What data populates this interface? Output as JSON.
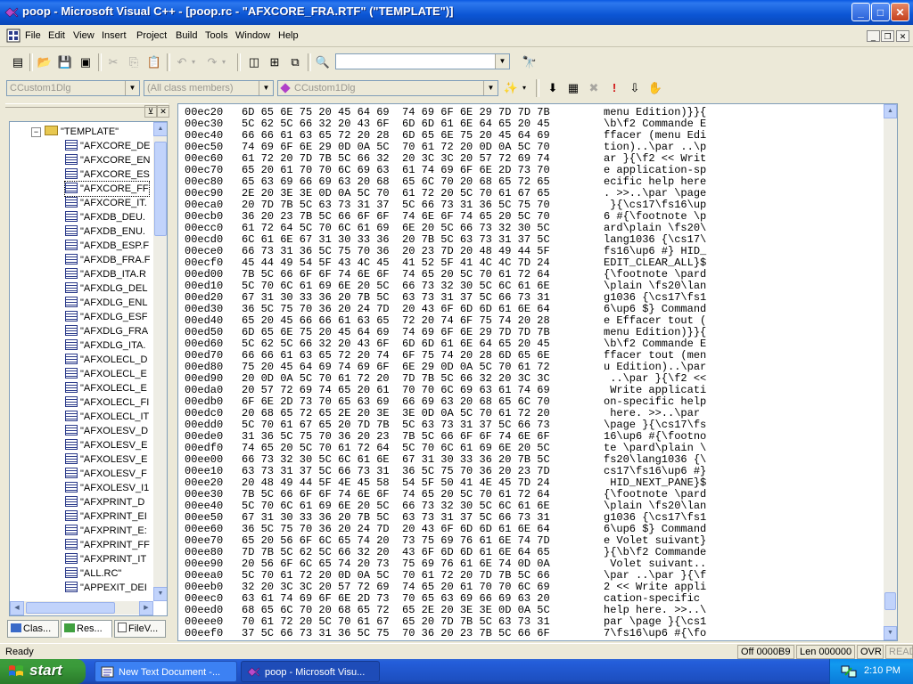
{
  "window": {
    "title": "poop - Microsoft Visual C++ - [poop.rc - \"AFXCORE_FRA.RTF\" (\"TEMPLATE\")]",
    "buttons": {
      "minimize": "_",
      "maximize": "□",
      "close": "✕"
    }
  },
  "menu": [
    "File",
    "Edit",
    "View",
    "Insert",
    "Project",
    "Build",
    "Tools",
    "Window",
    "Help"
  ],
  "wizardbar": {
    "class_combo": "CCustom1Dlg",
    "filter_combo": "(All class members)",
    "member_combo": "CCustom1Dlg"
  },
  "find_combo": "",
  "tree": {
    "root": "\"TEMPLATE\"",
    "items": [
      "\"AFXCORE_DE",
      "\"AFXCORE_EN",
      "\"AFXCORE_ES",
      "\"AFXCORE_FF",
      "\"AFXCORE_IT.",
      "\"AFXDB_DEU.",
      "\"AFXDB_ENU.",
      "\"AFXDB_ESP.F",
      "\"AFXDB_FRA.F",
      "\"AFXDB_ITA.R",
      "\"AFXDLG_DEL",
      "\"AFXDLG_ENL",
      "\"AFXDLG_ESF",
      "\"AFXDLG_FRA",
      "\"AFXDLG_ITA.",
      "\"AFXOLECL_D",
      "\"AFXOLECL_E",
      "\"AFXOLECL_E",
      "\"AFXOLECL_FI",
      "\"AFXOLECL_IT",
      "\"AFXOLESV_D",
      "\"AFXOLESV_E",
      "\"AFXOLESV_E",
      "\"AFXOLESV_F",
      "\"AFXOLESV_I1",
      "\"AFXPRINT_D",
      "\"AFXPRINT_EI",
      "\"AFXPRINT_E:",
      "\"AFXPRINT_FF",
      "\"AFXPRINT_IT",
      "\"ALL.RC\"",
      "\"APPEXIT_DEI"
    ]
  },
  "tabs": [
    "Clas...",
    "Res...",
    "FileV..."
  ],
  "hex_rows": [
    {
      "addr": "00ec20",
      "bytes": "6D 65 6E 75 20 45 64 69  74 69 6F 6E 29 7D 7D 7B",
      "ascii": "menu Edition)}}{"
    },
    {
      "addr": "00ec30",
      "bytes": "5C 62 5C 66 32 20 43 6F  6D 6D 61 6E 64 65 20 45",
      "ascii": "\\b\\f2 Commande E"
    },
    {
      "addr": "00ec40",
      "bytes": "66 66 61 63 65 72 20 28  6D 65 6E 75 20 45 64 69",
      "ascii": "ffacer (menu Edi"
    },
    {
      "addr": "00ec50",
      "bytes": "74 69 6F 6E 29 0D 0A 5C  70 61 72 20 0D 0A 5C 70",
      "ascii": "tion)..\\par ..\\p"
    },
    {
      "addr": "00ec60",
      "bytes": "61 72 20 7D 7B 5C 66 32  20 3C 3C 20 57 72 69 74",
      "ascii": "ar }{\\f2 << Writ"
    },
    {
      "addr": "00ec70",
      "bytes": "65 20 61 70 70 6C 69 63  61 74 69 6F 6E 2D 73 70",
      "ascii": "e application-sp"
    },
    {
      "addr": "00ec80",
      "bytes": "65 63 69 66 69 63 20 68  65 6C 70 20 68 65 72 65",
      "ascii": "ecific help here"
    },
    {
      "addr": "00ec90",
      "bytes": "2E 20 3E 3E 0D 0A 5C 70  61 72 20 5C 70 61 67 65",
      "ascii": ". >>..\\par \\page"
    },
    {
      "addr": "00eca0",
      "bytes": "20 7D 7B 5C 63 73 31 37  5C 66 73 31 36 5C 75 70",
      "ascii": " }{\\cs17\\fs16\\up"
    },
    {
      "addr": "00ecb0",
      "bytes": "36 20 23 7B 5C 66 6F 6F  74 6E 6F 74 65 20 5C 70",
      "ascii": "6 #{\\footnote \\p"
    },
    {
      "addr": "00ecc0",
      "bytes": "61 72 64 5C 70 6C 61 69  6E 20 5C 66 73 32 30 5C",
      "ascii": "ard\\plain \\fs20\\"
    },
    {
      "addr": "00ecd0",
      "bytes": "6C 61 6E 67 31 30 33 36  20 7B 5C 63 73 31 37 5C",
      "ascii": "lang1036 {\\cs17\\"
    },
    {
      "addr": "00ece0",
      "bytes": "66 73 31 36 5C 75 70 36  20 23 7D 20 48 49 44 5F",
      "ascii": "fs16\\up6 #} HID_"
    },
    {
      "addr": "00ecf0",
      "bytes": "45 44 49 54 5F 43 4C 45  41 52 5F 41 4C 4C 7D 24",
      "ascii": "EDIT_CLEAR_ALL}$"
    },
    {
      "addr": "00ed00",
      "bytes": "7B 5C 66 6F 6F 74 6E 6F  74 65 20 5C 70 61 72 64",
      "ascii": "{\\footnote \\pard"
    },
    {
      "addr": "00ed10",
      "bytes": "5C 70 6C 61 69 6E 20 5C  66 73 32 30 5C 6C 61 6E",
      "ascii": "\\plain \\fs20\\lan"
    },
    {
      "addr": "00ed20",
      "bytes": "67 31 30 33 36 20 7B 5C  63 73 31 37 5C 66 73 31",
      "ascii": "g1036 {\\cs17\\fs1"
    },
    {
      "addr": "00ed30",
      "bytes": "36 5C 75 70 36 20 24 7D  20 43 6F 6D 6D 61 6E 64",
      "ascii": "6\\up6 $} Command"
    },
    {
      "addr": "00ed40",
      "bytes": "65 20 45 66 66 61 63 65  72 20 74 6F 75 74 20 28",
      "ascii": "e Effacer tout ("
    },
    {
      "addr": "00ed50",
      "bytes": "6D 65 6E 75 20 45 64 69  74 69 6F 6E 29 7D 7D 7B",
      "ascii": "menu Edition)}}{"
    },
    {
      "addr": "00ed60",
      "bytes": "5C 62 5C 66 32 20 43 6F  6D 6D 61 6E 64 65 20 45",
      "ascii": "\\b\\f2 Commande E"
    },
    {
      "addr": "00ed70",
      "bytes": "66 66 61 63 65 72 20 74  6F 75 74 20 28 6D 65 6E",
      "ascii": "ffacer tout (men"
    },
    {
      "addr": "00ed80",
      "bytes": "75 20 45 64 69 74 69 6F  6E 29 0D 0A 5C 70 61 72",
      "ascii": "u Edition)..\\par"
    },
    {
      "addr": "00ed90",
      "bytes": "20 0D 0A 5C 70 61 72 20  7D 7B 5C 66 32 20 3C 3C",
      "ascii": " ..\\par }{\\f2 <<"
    },
    {
      "addr": "00eda0",
      "bytes": "20 57 72 69 74 65 20 61  70 70 6C 69 63 61 74 69",
      "ascii": " Write applicati"
    },
    {
      "addr": "00edb0",
      "bytes": "6F 6E 2D 73 70 65 63 69  66 69 63 20 68 65 6C 70",
      "ascii": "on-specific help"
    },
    {
      "addr": "00edc0",
      "bytes": "20 68 65 72 65 2E 20 3E  3E 0D 0A 5C 70 61 72 20",
      "ascii": " here. >>..\\par "
    },
    {
      "addr": "00edd0",
      "bytes": "5C 70 61 67 65 20 7D 7B  5C 63 73 31 37 5C 66 73",
      "ascii": "\\page }{\\cs17\\fs"
    },
    {
      "addr": "00ede0",
      "bytes": "31 36 5C 75 70 36 20 23  7B 5C 66 6F 6F 74 6E 6F",
      "ascii": "16\\up6 #{\\footno"
    },
    {
      "addr": "00edf0",
      "bytes": "74 65 20 5C 70 61 72 64  5C 70 6C 61 69 6E 20 5C",
      "ascii": "te \\pard\\plain \\"
    },
    {
      "addr": "00ee00",
      "bytes": "66 73 32 30 5C 6C 61 6E  67 31 30 33 36 20 7B 5C",
      "ascii": "fs20\\lang1036 {\\"
    },
    {
      "addr": "00ee10",
      "bytes": "63 73 31 37 5C 66 73 31  36 5C 75 70 36 20 23 7D",
      "ascii": "cs17\\fs16\\up6 #}"
    },
    {
      "addr": "00ee20",
      "bytes": "20 48 49 44 5F 4E 45 58  54 5F 50 41 4E 45 7D 24",
      "ascii": " HID_NEXT_PANE}$"
    },
    {
      "addr": "00ee30",
      "bytes": "7B 5C 66 6F 6F 74 6E 6F  74 65 20 5C 70 61 72 64",
      "ascii": "{\\footnote \\pard"
    },
    {
      "addr": "00ee40",
      "bytes": "5C 70 6C 61 69 6E 20 5C  66 73 32 30 5C 6C 61 6E",
      "ascii": "\\plain \\fs20\\lan"
    },
    {
      "addr": "00ee50",
      "bytes": "67 31 30 33 36 20 7B 5C  63 73 31 37 5C 66 73 31",
      "ascii": "g1036 {\\cs17\\fs1"
    },
    {
      "addr": "00ee60",
      "bytes": "36 5C 75 70 36 20 24 7D  20 43 6F 6D 6D 61 6E 64",
      "ascii": "6\\up6 $} Command"
    },
    {
      "addr": "00ee70",
      "bytes": "65 20 56 6F 6C 65 74 20  73 75 69 76 61 6E 74 7D",
      "ascii": "e Volet suivant}"
    },
    {
      "addr": "00ee80",
      "bytes": "7D 7B 5C 62 5C 66 32 20  43 6F 6D 6D 61 6E 64 65",
      "ascii": "}{\\b\\f2 Commande"
    },
    {
      "addr": "00ee90",
      "bytes": "20 56 6F 6C 65 74 20 73  75 69 76 61 6E 74 0D 0A",
      "ascii": " Volet suivant.."
    },
    {
      "addr": "00eea0",
      "bytes": "5C 70 61 72 20 0D 0A 5C  70 61 72 20 7D 7B 5C 66",
      "ascii": "\\par ..\\par }{\\f"
    },
    {
      "addr": "00eeb0",
      "bytes": "32 20 3C 3C 20 57 72 69  74 65 20 61 70 70 6C 69",
      "ascii": "2 << Write appli"
    },
    {
      "addr": "00eec0",
      "bytes": "63 61 74 69 6F 6E 2D 73  70 65 63 69 66 69 63 20",
      "ascii": "cation-specific "
    },
    {
      "addr": "00eed0",
      "bytes": "68 65 6C 70 20 68 65 72  65 2E 20 3E 3E 0D 0A 5C",
      "ascii": "help here. >>..\\"
    },
    {
      "addr": "00eee0",
      "bytes": "70 61 72 20 5C 70 61 67  65 20 7D 7B 5C 63 73 31",
      "ascii": "par \\page }{\\cs1"
    },
    {
      "addr": "00eef0",
      "bytes": "37 5C 66 73 31 36 5C 75  70 36 20 23 7B 5C 66 6F",
      "ascii": "7\\fs16\\up6 #{\\fo"
    }
  ],
  "status": {
    "ready": "Ready",
    "offset": "Off 0000B9",
    "length": "Len 000000",
    "ovr": "OVR",
    "read": "READ"
  },
  "taskbar": {
    "start": "start",
    "tasks": [
      "New Text Document -...",
      "poop - Microsoft Visu..."
    ],
    "clock": "2:10 PM"
  },
  "colors": {
    "titlebar": "#0a58e2",
    "taskbar": "#245edb",
    "start": "#3a9a3a",
    "tray": "#129af0"
  }
}
